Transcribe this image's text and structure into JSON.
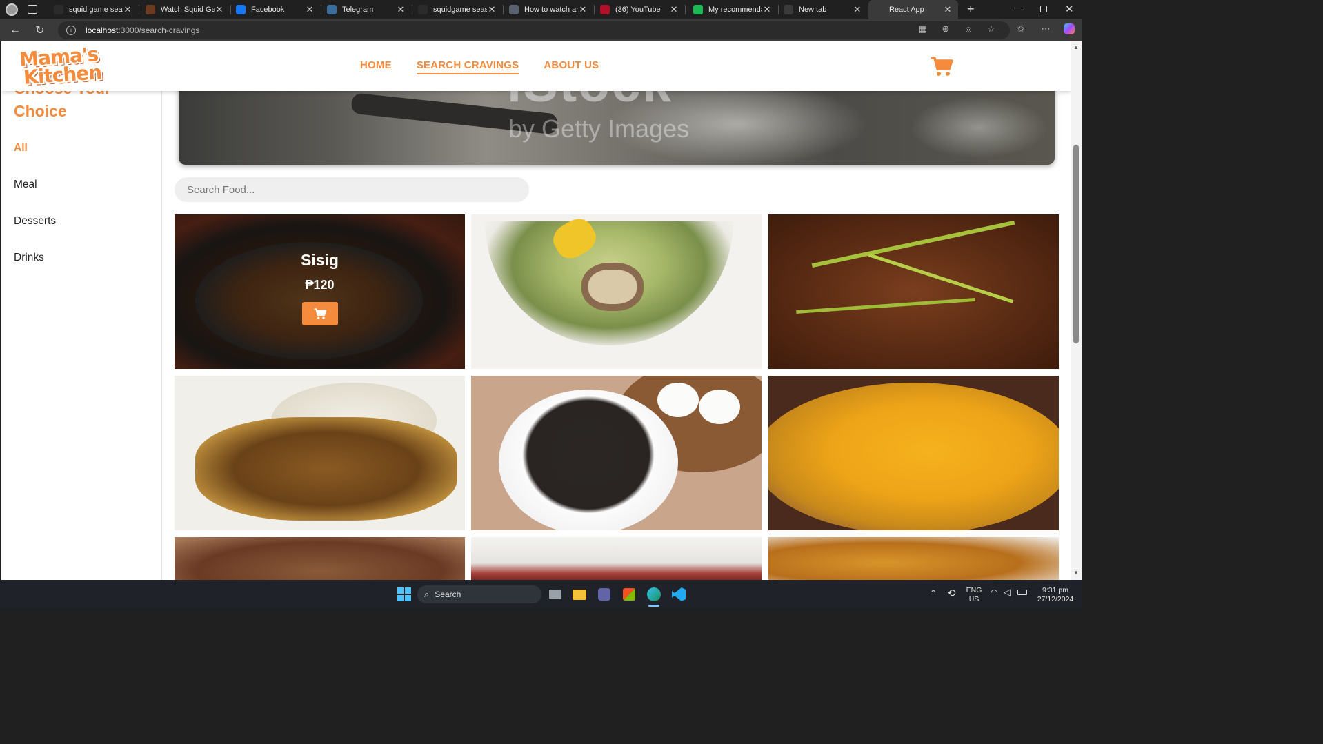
{
  "browser": {
    "tabs": [
      {
        "title": "squid game season",
        "icon": "search-favicon",
        "color": "#2b2b2b"
      },
      {
        "title": "Watch Squid Game",
        "icon": "squid-favicon",
        "color": "#6b3b1f"
      },
      {
        "title": "Facebook",
        "icon": "facebook-favicon",
        "color": "#1877f2"
      },
      {
        "title": "Telegram",
        "icon": "telegram-favicon",
        "color": "#3a6d99"
      },
      {
        "title": "squidgame season",
        "icon": "search-favicon",
        "color": "#2b2b2b"
      },
      {
        "title": "How to watch and",
        "icon": "page-favicon",
        "color": "#5a6270"
      },
      {
        "title": "(36) YouTube",
        "icon": "youtube-favicon",
        "color": "#b0102a"
      },
      {
        "title": "My recommendati",
        "icon": "spotify-favicon",
        "color": "#1db954"
      },
      {
        "title": "New tab",
        "icon": "newtab-favicon",
        "color": "#3a3a3a"
      },
      {
        "title": "React App",
        "icon": "react-favicon",
        "color": "#3a3a3a"
      }
    ],
    "url_host": "localhost",
    "url_path": ":3000/search-cravings"
  },
  "site": {
    "brand_line1": "Mama's",
    "brand_line2": "Kitchen",
    "nav": {
      "home": "HOME",
      "search": "SEARCH CRAVINGS",
      "about": "ABOUT US"
    },
    "active_nav": "SEARCH CRAVINGS",
    "accent_color": "#f58b3c"
  },
  "sidebar": {
    "title": "Choose Your Choice",
    "categories": [
      {
        "label": "All"
      },
      {
        "label": "Meal"
      },
      {
        "label": "Desserts"
      },
      {
        "label": "Drinks"
      }
    ],
    "active": "All"
  },
  "banner": {
    "watermark_main": "iStock",
    "watermark_sub": "by Getty Images"
  },
  "search": {
    "placeholder": "Search Food..."
  },
  "foods": [
    {
      "name": "Sisig",
      "price": "₱120",
      "hovered": true,
      "image": "sisig-sizzling-plate"
    },
    {
      "name": "",
      "price": "",
      "hovered": false,
      "image": "bulalo-soup-bowl"
    },
    {
      "name": "",
      "price": "",
      "hovered": false,
      "image": "beef-stew-chili-strips"
    },
    {
      "name": "",
      "price": "",
      "hovered": false,
      "image": "adobo-chicken-rice"
    },
    {
      "name": "",
      "price": "",
      "hovered": false,
      "image": "dinuguan-puto-bowl"
    },
    {
      "name": "",
      "price": "",
      "hovered": false,
      "image": "kare-kare-sauce"
    },
    {
      "name": "",
      "price": "",
      "hovered": false,
      "image": "partial-dish-1"
    },
    {
      "name": "",
      "price": "",
      "hovered": false,
      "image": "partial-dish-2"
    },
    {
      "name": "",
      "price": "",
      "hovered": false,
      "image": "lumpia-partial"
    }
  ],
  "taskbar": {
    "search_label": "Search",
    "lang_line1": "ENG",
    "lang_line2": "US",
    "time": "9:31 pm",
    "date": "27/12/2024"
  }
}
